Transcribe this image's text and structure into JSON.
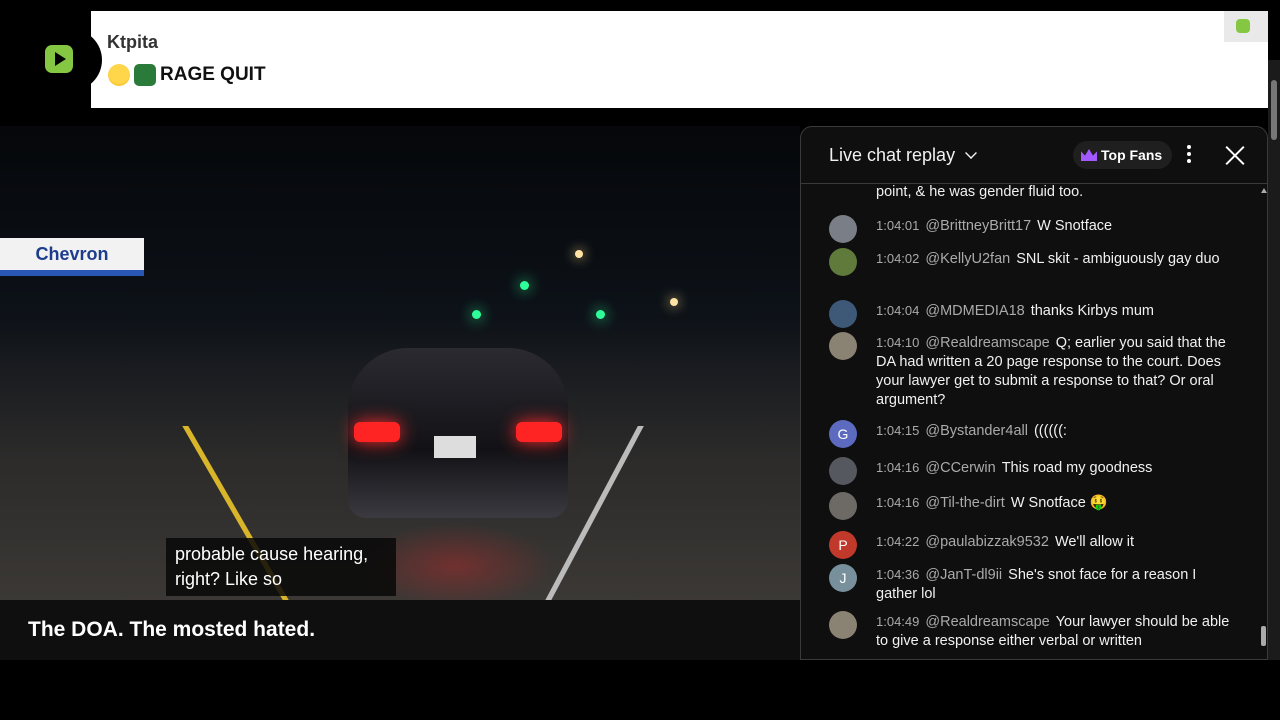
{
  "notification": {
    "username": "Ktpita",
    "message": "RAGE QUIT",
    "emojis": [
      "rolling-laughing-emoji",
      "rage-emote"
    ],
    "brand_color": "#85c742"
  },
  "video": {
    "caption_line1": "probable cause hearing,",
    "caption_line2": "right? Like so",
    "sign_text": "Chevron",
    "title": "The DOA. The mosted hated."
  },
  "chat": {
    "title": "Live chat replay",
    "top_fans_label": "Top Fans",
    "continued_text": "point, & he was gender fluid too.",
    "messages": [
      {
        "time": "1:04:01",
        "author": "@BrittneyBritt17",
        "text": "W Snotface",
        "avatar_color": "#7a7f87",
        "avatar_letter": ""
      },
      {
        "time": "1:04:02",
        "author": "@KellyU2fan",
        "text": "SNL skit - ambiguously gay duo",
        "avatar_color": "#5f7a3a",
        "avatar_letter": ""
      },
      {
        "time": "1:04:04",
        "author": "@MDMEDIA18",
        "text": "thanks Kirbys mum",
        "avatar_color": "#3e5878",
        "avatar_letter": ""
      },
      {
        "time": "1:04:10",
        "author": "@Realdreamscape",
        "text": "Q; earlier you said that the DA had written a 20 page response to the court. Does your lawyer get to submit a response to that? Or oral argument?",
        "avatar_color": "#8a8272",
        "avatar_letter": ""
      },
      {
        "time": "1:04:15",
        "author": "@Bystander4all",
        "text": "((((((:",
        "avatar_color": "#5c6bc0",
        "avatar_letter": "G"
      },
      {
        "time": "1:04:16",
        "author": "@CCerwin",
        "text": "This road my goodness",
        "avatar_color": "#55585e",
        "avatar_letter": ""
      },
      {
        "time": "1:04:16",
        "author": "@Til-the-dirt",
        "text": "W Snotface 🤑",
        "avatar_color": "#6d6a66",
        "avatar_letter": ""
      },
      {
        "time": "1:04:22",
        "author": "@paulabizzak9532",
        "text": "We'll allow it",
        "avatar_color": "#c0392b",
        "avatar_letter": "P"
      },
      {
        "time": "1:04:36",
        "author": "@JanT-dl9ii",
        "text": "She's snot face for a reason I gather lol",
        "avatar_color": "#78909c",
        "avatar_letter": "J"
      },
      {
        "time": "1:04:49",
        "author": "@Realdreamscape",
        "text": "Your lawyer should be able to give a response either verbal or written",
        "avatar_color": "#8a8272",
        "avatar_letter": ""
      }
    ]
  }
}
